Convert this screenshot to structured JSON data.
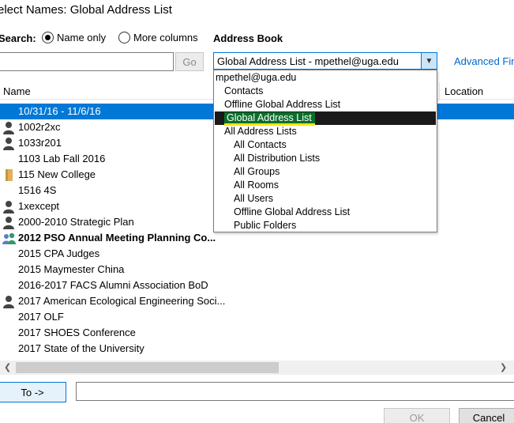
{
  "window": {
    "title": "elect Names: Global Address List"
  },
  "search": {
    "label": "Search:",
    "options": [
      {
        "label": "Name only",
        "selected": true
      },
      {
        "label": "More columns",
        "selected": false
      }
    ],
    "query": "",
    "go_label": "Go"
  },
  "address_book": {
    "label": "Address Book",
    "selected": "Global Address List - mpethel@uga.edu",
    "advanced_link": "Advanced Fin",
    "dropdown_items": [
      {
        "label": "mpethel@uga.edu",
        "level": 0
      },
      {
        "label": "Contacts",
        "level": 1
      },
      {
        "label": "Offline Global Address List",
        "level": 1
      },
      {
        "label": "Global Address List",
        "level": 1,
        "selected": true
      },
      {
        "label": "All Address Lists",
        "level": 1
      },
      {
        "label": "All Contacts",
        "level": 2
      },
      {
        "label": "All Distribution Lists",
        "level": 2
      },
      {
        "label": "All Groups",
        "level": 2
      },
      {
        "label": "All Rooms",
        "level": 2
      },
      {
        "label": "All Users",
        "level": 2
      },
      {
        "label": "Offline Global Address List",
        "level": 2
      },
      {
        "label": "Public Folders",
        "level": 2
      }
    ]
  },
  "list": {
    "columns": [
      "Name",
      "Location"
    ],
    "rows": [
      {
        "name": "10/31/16 - 11/6/16",
        "icon": "none",
        "selected": true
      },
      {
        "name": "1002r2xc",
        "icon": "person-icon"
      },
      {
        "name": "1033r201",
        "icon": "person-icon"
      },
      {
        "name": "1103 Lab Fall 2016",
        "icon": "none"
      },
      {
        "name": "115 New College",
        "icon": "room-icon"
      },
      {
        "name": "1516 4S",
        "icon": "none"
      },
      {
        "name": "1xexcept",
        "icon": "person-icon"
      },
      {
        "name": "2000-2010 Strategic Plan",
        "icon": "person-icon"
      },
      {
        "name": "2012 PSO Annual Meeting Planning Co...",
        "icon": "group-icon",
        "bold": true
      },
      {
        "name": "2015 CPA Judges",
        "icon": "none"
      },
      {
        "name": "2015 Maymester China",
        "icon": "none"
      },
      {
        "name": "2016-2017 FACS Alumni Association BoD",
        "icon": "none"
      },
      {
        "name": "2017 American Ecological Engineering Soci...",
        "icon": "person-icon"
      },
      {
        "name": "2017 OLF",
        "icon": "none"
      },
      {
        "name": "2017 SHOES Conference",
        "icon": "none"
      },
      {
        "name": "2017 State of the University",
        "icon": "none"
      }
    ]
  },
  "footer": {
    "to_label": "To ->",
    "to_value": "",
    "ok_label": "OK",
    "cancel_label": "Cancel"
  },
  "colors": {
    "accent": "#0078d7",
    "highlight_green": "#0a6f2a",
    "highlight_yellow": "#f5e600"
  }
}
